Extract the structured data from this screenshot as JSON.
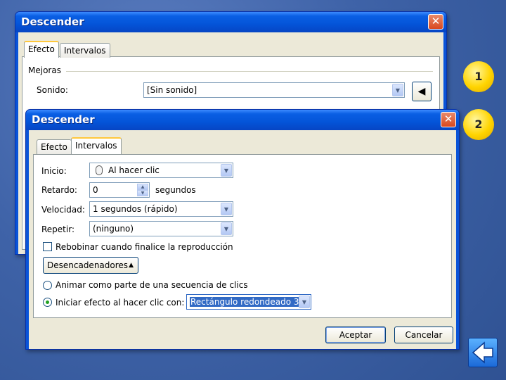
{
  "back_dialog": {
    "title": "Descender",
    "tabs": [
      "Efecto",
      "Intervalos"
    ],
    "group_label": "Mejoras",
    "sound_label": "Sonido:",
    "sound_value": "[Sin sonido]"
  },
  "front_dialog": {
    "title": "Descender",
    "tabs": [
      "Efecto",
      "Intervalos"
    ],
    "inicio_label": "Inicio:",
    "inicio_value": "Al hacer clic",
    "retardo_label": "Retardo:",
    "retardo_value": "0",
    "retardo_unit": "segundos",
    "velocidad_label": "Velocidad:",
    "velocidad_value": "1 segundos (rápido)",
    "repetir_label": "Repetir:",
    "repetir_value": "(ninguno)",
    "rewind_label": "Rebobinar cuando finalice la reproducción",
    "triggers_label": "Desencadenadores",
    "radio_sequence_label": "Animar como parte de una secuencia de clics",
    "radio_click_label": "Iniciar efecto al hacer clic con:",
    "radio_click_value": "Rectángulo redondeado 3:",
    "ok_label": "Aceptar",
    "cancel_label": "Cancelar"
  },
  "badges": [
    "1",
    "2"
  ],
  "colors": {
    "background": "#3f63a8",
    "titlebar": "#0454d8",
    "badge": "#ffd400"
  }
}
